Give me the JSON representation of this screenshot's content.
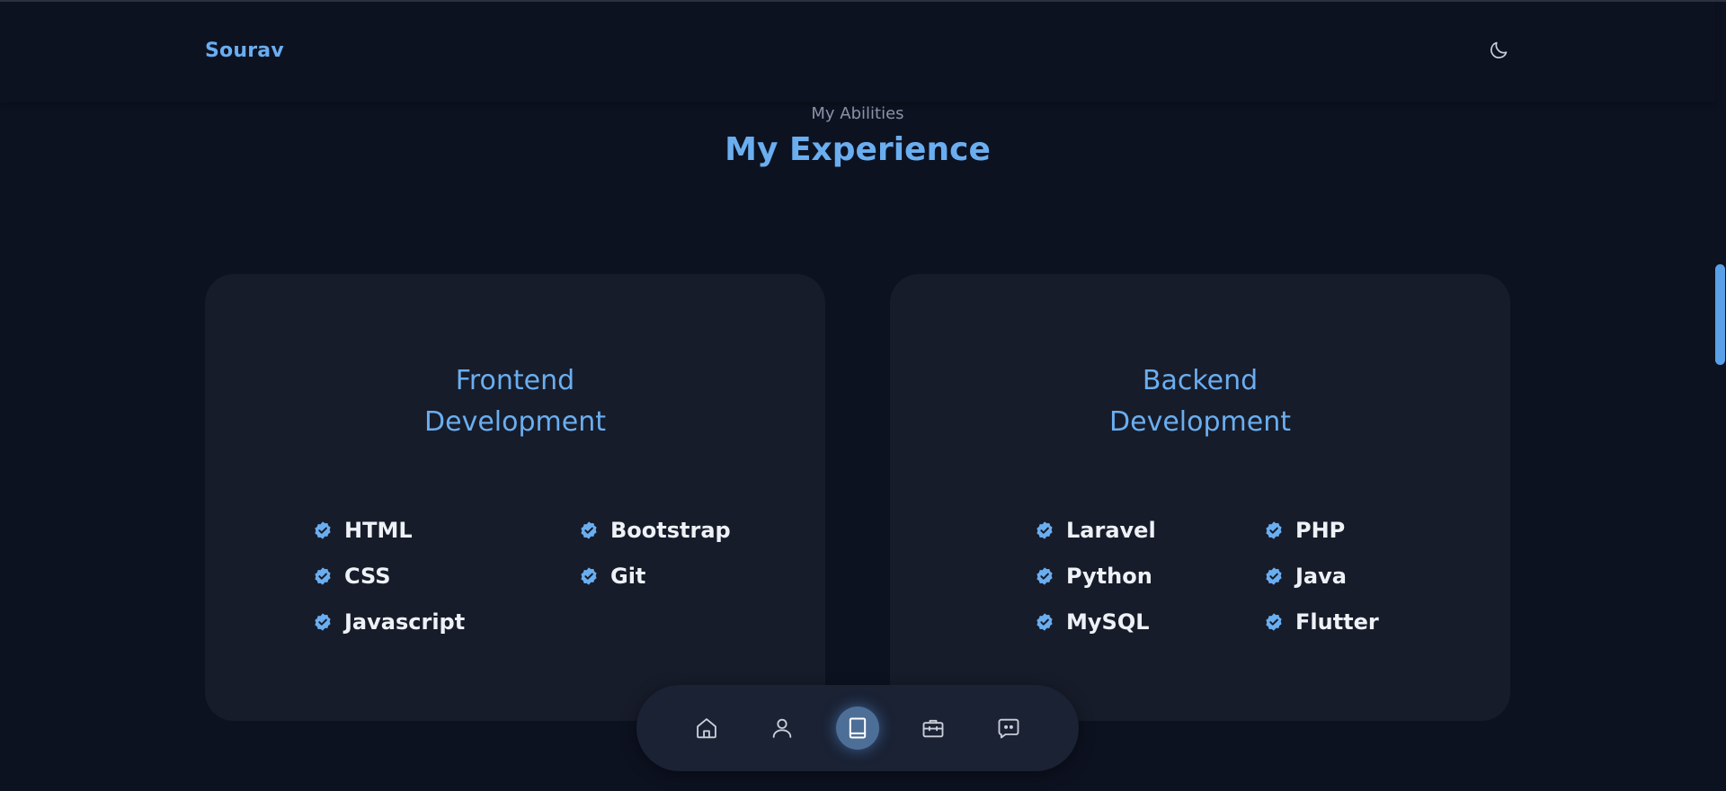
{
  "header": {
    "logo": "Sourav",
    "theme_toggle_icon": "moon-icon"
  },
  "section": {
    "subtitle": "My Abilities",
    "title": "My Experience"
  },
  "cards": [
    {
      "title_line1": "Frontend",
      "title_line2": "Development",
      "skills": [
        "HTML",
        "Bootstrap",
        "CSS",
        "Git",
        "Javascript"
      ]
    },
    {
      "title_line1": "Backend",
      "title_line2": "Development",
      "skills": [
        "Laravel",
        "PHP",
        "Python",
        "Java",
        "MySQL",
        "Flutter"
      ]
    }
  ],
  "bottom_nav": {
    "items": [
      {
        "icon": "home-icon"
      },
      {
        "icon": "user-icon"
      },
      {
        "icon": "book-icon",
        "active": true
      },
      {
        "icon": "briefcase-icon"
      },
      {
        "icon": "message-icon"
      }
    ]
  },
  "colors": {
    "accent": "#6aaef0",
    "background": "#0d1221",
    "card": "#171c2a",
    "text": "#eef1f6",
    "muted": "#8b93a7"
  }
}
